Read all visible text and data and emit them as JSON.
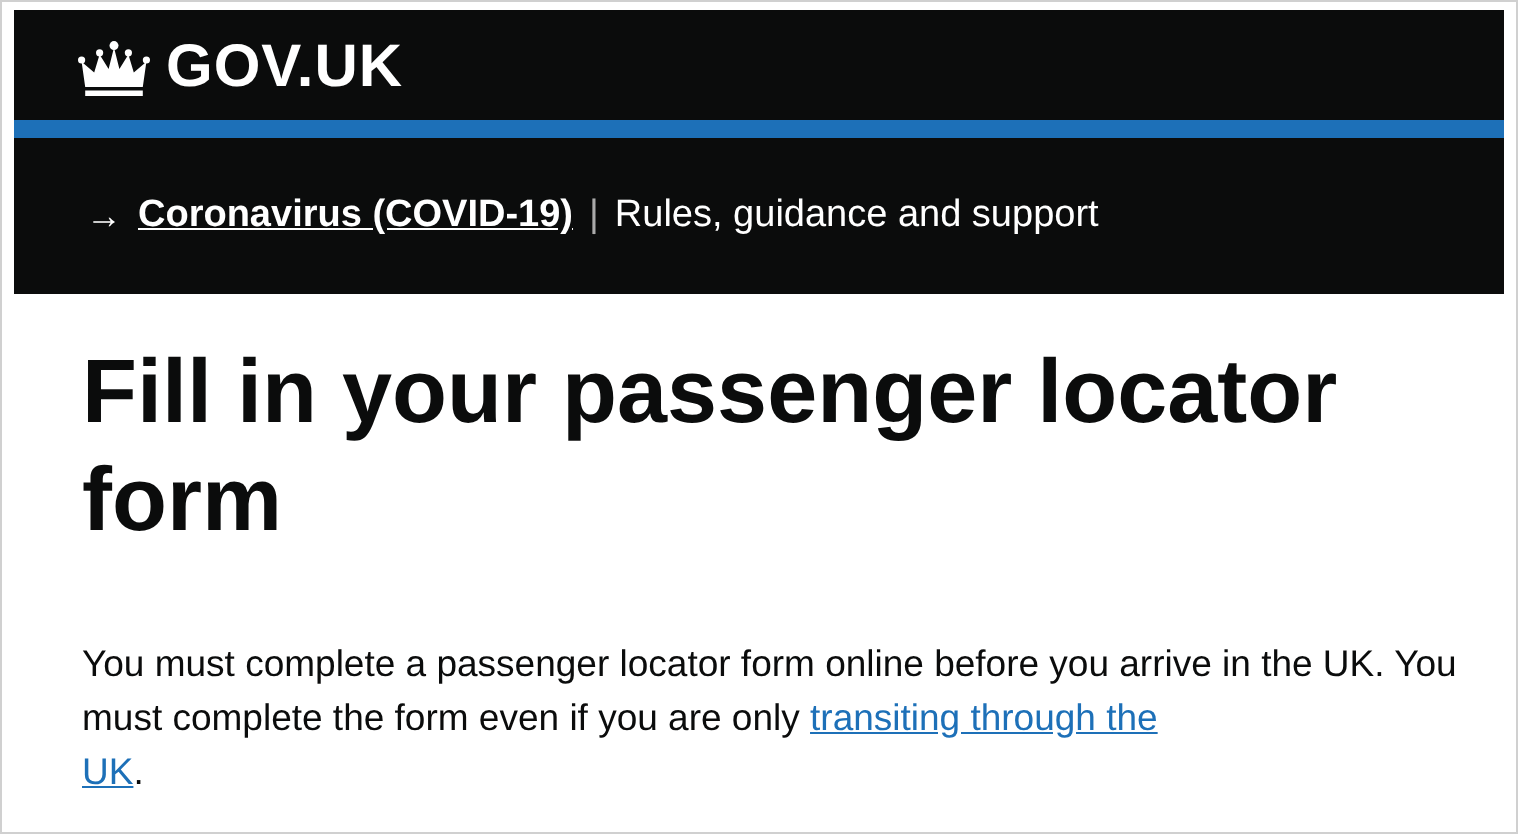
{
  "header": {
    "logo_text": "GOV.UK",
    "banner": {
      "arrow": "→",
      "link": "Coronavirus (COVID-19)",
      "separator": "|",
      "description": "Rules, guidance and support"
    }
  },
  "title": "Fill in your passenger locator form",
  "intro": {
    "before": "You must complete a passenger locator form online before you arrive in the UK. You must complete the form even if you are only ",
    "link_lines": [
      "transiting through the",
      "UK"
    ],
    "after": "."
  }
}
